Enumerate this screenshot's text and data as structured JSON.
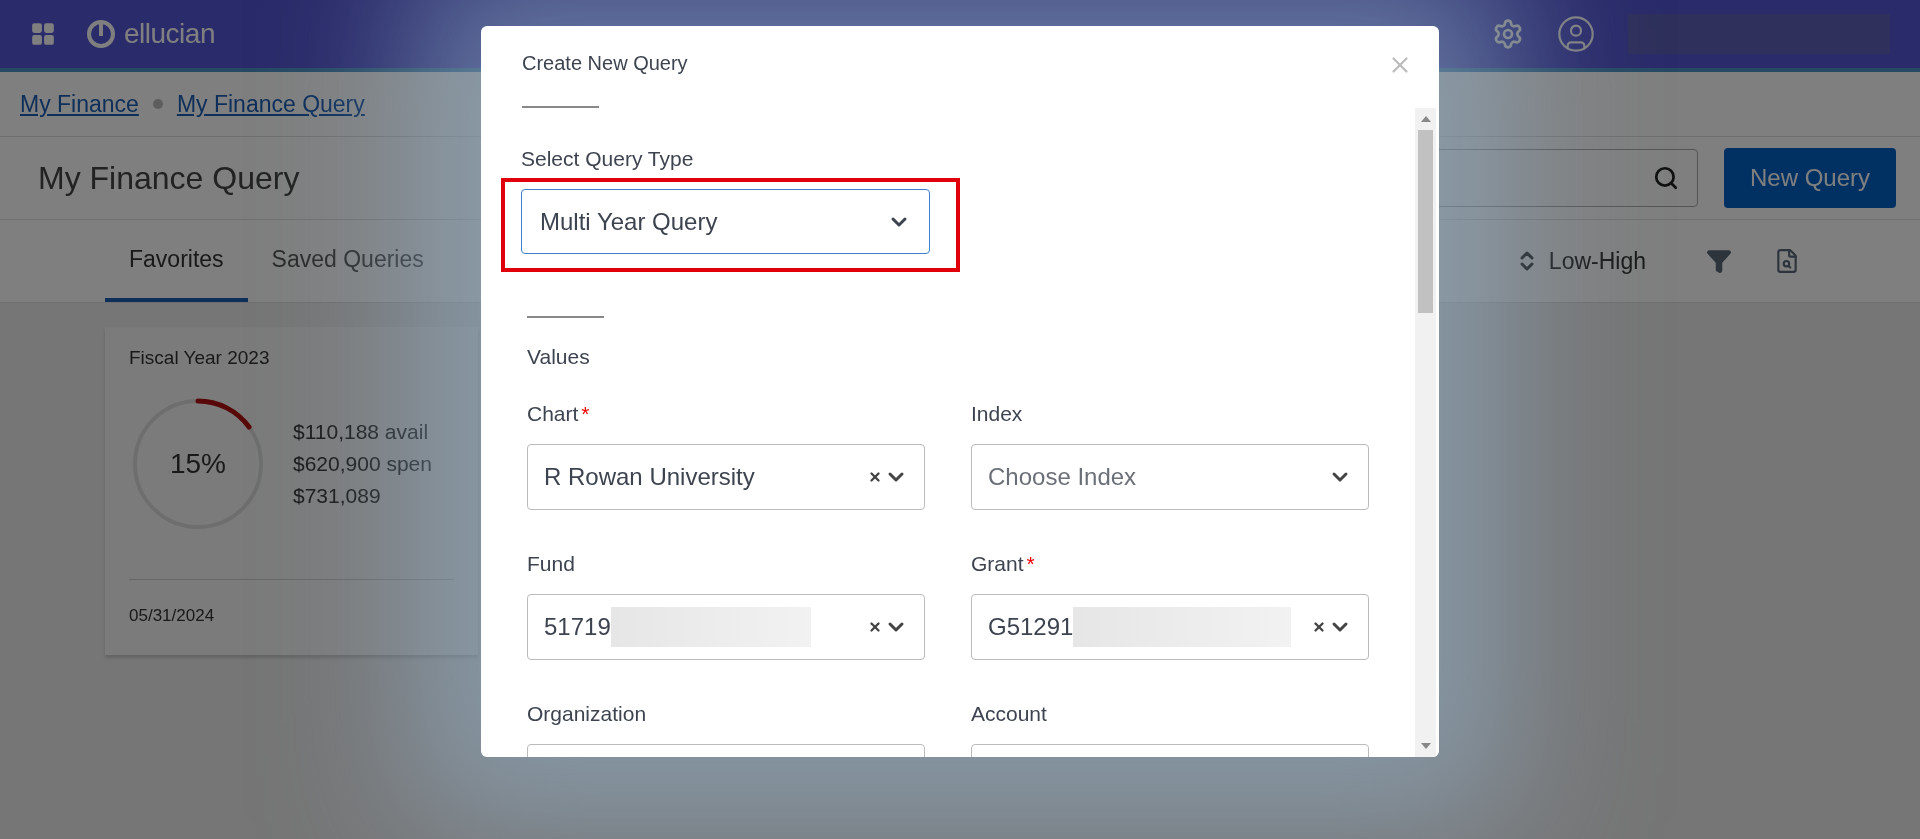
{
  "top_bar": {
    "logo_text": "ellucian"
  },
  "breadcrumb": [
    {
      "label": "My Finance"
    },
    {
      "label": "My Finance Query"
    }
  ],
  "page_title": "My Finance Query",
  "new_query_button": "New Query",
  "tabs": [
    {
      "label": "Favorites",
      "selected": true
    },
    {
      "label": "Saved Queries",
      "selected": false
    }
  ],
  "sort": {
    "label": "Low-High"
  },
  "card": {
    "title": "Fiscal Year 2023",
    "gauge": {
      "level": 0.15,
      "reading": "15%"
    },
    "amounts": [
      "$110,188 avail",
      "$620,900 spen",
      "$731,089"
    ],
    "date": "05/31/2024"
  },
  "modal": {
    "title": "Create New Query",
    "query_type": {
      "label": "Select Query Type",
      "value": "Multi Year Query",
      "highlighted": true
    },
    "section": "Values",
    "fields": [
      {
        "label": "Chart",
        "required_mark": "*",
        "value": "R Rowan University",
        "clearable": true,
        "redacted": false
      },
      {
        "label": "Index",
        "placeholder": "Choose Index",
        "clearable": false,
        "redacted": false
      },
      {
        "label": "Fund",
        "value": "51719",
        "redacted": true,
        "clearable": true
      },
      {
        "label": "Grant",
        "required_mark": "*",
        "value": "G51291",
        "redacted": true,
        "clearable": true
      },
      {
        "label": "Organization"
      },
      {
        "label": "Account"
      }
    ]
  }
}
